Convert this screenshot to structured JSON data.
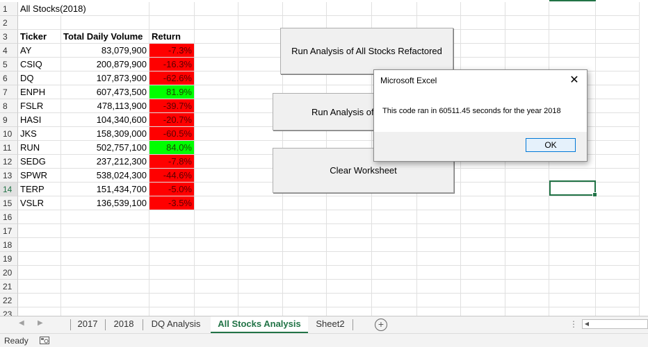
{
  "sheet": {
    "title_cell": "All Stocks(2018)",
    "headers": [
      "Ticker",
      "Total Daily Volume",
      "Return"
    ],
    "rows": [
      {
        "ticker": "AY",
        "volume": "83,079,900",
        "ret": "-7.3%",
        "sign": "neg"
      },
      {
        "ticker": "CSIQ",
        "volume": "200,879,900",
        "ret": "-16.3%",
        "sign": "neg"
      },
      {
        "ticker": "DQ",
        "volume": "107,873,900",
        "ret": "-62.6%",
        "sign": "neg"
      },
      {
        "ticker": "ENPH",
        "volume": "607,473,500",
        "ret": "81.9%",
        "sign": "pos"
      },
      {
        "ticker": "FSLR",
        "volume": "478,113,900",
        "ret": "-39.7%",
        "sign": "neg"
      },
      {
        "ticker": "HASI",
        "volume": "104,340,600",
        "ret": "-20.7%",
        "sign": "neg"
      },
      {
        "ticker": "JKS",
        "volume": "158,309,000",
        "ret": "-60.5%",
        "sign": "neg"
      },
      {
        "ticker": "RUN",
        "volume": "502,757,100",
        "ret": "84.0%",
        "sign": "pos"
      },
      {
        "ticker": "SEDG",
        "volume": "237,212,300",
        "ret": "-7.8%",
        "sign": "neg"
      },
      {
        "ticker": "SPWR",
        "volume": "538,024,300",
        "ret": "-44.6%",
        "sign": "neg"
      },
      {
        "ticker": "TERP",
        "volume": "151,434,700",
        "ret": "-5.0%",
        "sign": "neg"
      },
      {
        "ticker": "VSLR",
        "volume": "136,539,100",
        "ret": "-3.5%",
        "sign": "neg"
      }
    ],
    "row_numbers": [
      "1",
      "2",
      "3",
      "4",
      "5",
      "6",
      "7",
      "8",
      "9",
      "10",
      "11",
      "12",
      "13",
      "14",
      "15",
      "16",
      "17",
      "18",
      "19",
      "20",
      "21",
      "22",
      "23"
    ],
    "selected_row_number": "14",
    "colors": {
      "negative": "#ff0000",
      "positive": "#00ff00",
      "accent": "#217346"
    }
  },
  "buttons": {
    "refactored": "Run Analysis of All Stocks Refactored",
    "original": "Run Analysis of",
    "clear": "Clear Worksheet"
  },
  "dialog": {
    "title": "Microsoft Excel",
    "message": "This code ran in 60511.45 seconds for the year 2018",
    "ok": "OK",
    "close_icon": "close-icon"
  },
  "tabs": {
    "items": [
      "2017",
      "2018",
      "DQ Analysis",
      "All Stocks Analysis",
      "Sheet2"
    ],
    "active": "All Stocks Analysis",
    "add_icon": "plus-circle-icon",
    "more": "⋮"
  },
  "status": {
    "text": "Ready",
    "macro_icon": "macro-recording-icon"
  }
}
